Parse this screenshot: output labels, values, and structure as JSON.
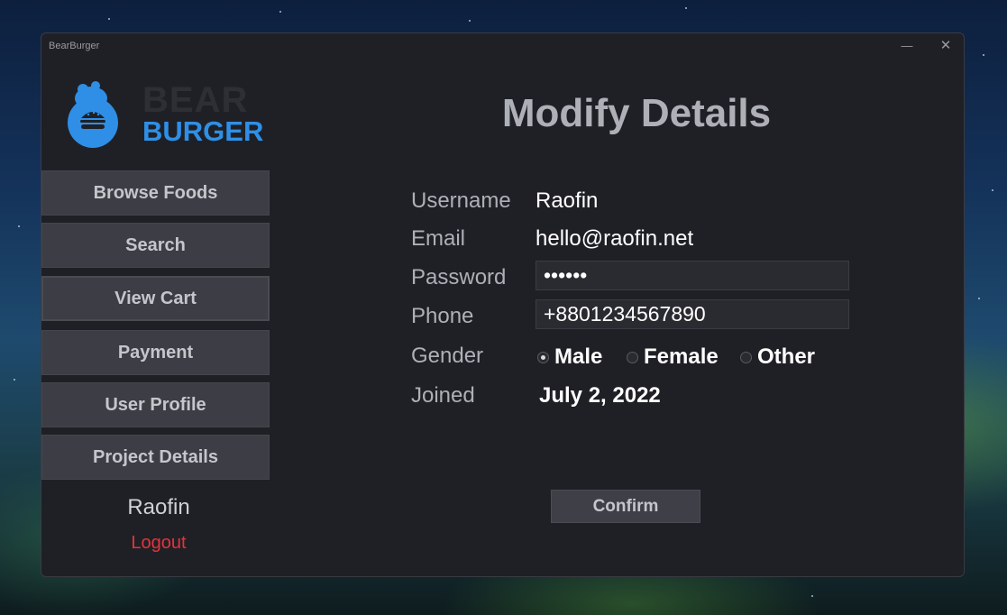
{
  "window": {
    "title": "BearBurger",
    "minimize_glyph": "—",
    "close_glyph": "✕"
  },
  "logo": {
    "line1": "BEAR",
    "line2": "BURGER",
    "icon": "bear-burger-logo",
    "accent_color": "#2f8fe6"
  },
  "sidebar": {
    "items": [
      {
        "label": "Browse Foods"
      },
      {
        "label": "Search"
      },
      {
        "label": "View Cart"
      },
      {
        "label": "Payment"
      },
      {
        "label": "User Profile"
      },
      {
        "label": "Project Details"
      }
    ],
    "username": "Raofin",
    "logout_label": "Logout"
  },
  "form": {
    "title": "Modify Details",
    "username": {
      "label": "Username",
      "value": "Raofin"
    },
    "email": {
      "label": "Email",
      "value": "hello@raofin.net"
    },
    "password": {
      "label": "Password",
      "value": "••••••"
    },
    "phone": {
      "label": "Phone",
      "value": "+8801234567890"
    },
    "gender": {
      "label": "Gender",
      "options": [
        "Male",
        "Female",
        "Other"
      ],
      "selected": "Male"
    },
    "joined": {
      "label": "Joined",
      "value": "July 2, 2022"
    },
    "confirm_label": "Confirm"
  },
  "colors": {
    "window_bg": "#1f2026",
    "button_bg": "#3d3e45",
    "logout": "#e5333b"
  }
}
